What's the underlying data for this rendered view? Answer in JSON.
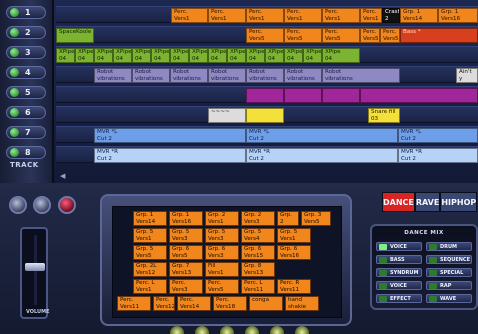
{
  "track_panel": {
    "tracks": [
      {
        "num": "1"
      },
      {
        "num": "2"
      },
      {
        "num": "3"
      },
      {
        "num": "4"
      },
      {
        "num": "5"
      },
      {
        "num": "6"
      },
      {
        "num": "7"
      },
      {
        "num": "8"
      }
    ],
    "label": "TRACK"
  },
  "lanes": [
    {
      "clips": [
        {
          "text": "Perc.\nVers1",
          "color": "orange"
        },
        {
          "text": "Perc.\nVers1",
          "color": "orange"
        },
        {
          "text": "Perc.\nVers1",
          "color": "orange"
        },
        {
          "text": "Perc.\nVers1",
          "color": "orange"
        },
        {
          "text": "Perc.\nVers1",
          "color": "orange"
        },
        {
          "text": "Perc.\nVers1",
          "color": "orange"
        },
        {
          "text": "Crash\n2",
          "color": "dark"
        },
        {
          "text": "Grp. 1\nVers14",
          "color": "orange"
        },
        {
          "text": "Grp. 1\nVers16",
          "color": "orange"
        }
      ]
    },
    {
      "clips": [
        {
          "text": "SpaceKoole",
          "color": "green"
        },
        {
          "text": "Perc.\nVers5",
          "color": "orange"
        },
        {
          "text": "Perc.\nVers5",
          "color": "orange"
        },
        {
          "text": "Perc.\nVers5",
          "color": "orange"
        },
        {
          "text": "Perc.\nVers5",
          "color": "orange"
        },
        {
          "text": "Perc.\nVers5",
          "color": "orange"
        },
        {
          "text": "Bass *",
          "color": "red"
        }
      ]
    },
    {
      "clips": [
        {
          "text": "XPipe\n04",
          "color": "green"
        },
        {
          "text": "XPipe\n04",
          "color": "green"
        },
        {
          "text": "XPipe\n04",
          "color": "green"
        },
        {
          "text": "XPipe\n04",
          "color": "green"
        },
        {
          "text": "XPipe\n04",
          "color": "green"
        },
        {
          "text": "XPipe\n04",
          "color": "green"
        },
        {
          "text": "XPipe\n04",
          "color": "green"
        },
        {
          "text": "XPipe\n04",
          "color": "green"
        },
        {
          "text": "XPipe\n04",
          "color": "green"
        },
        {
          "text": "XPipe\n04",
          "color": "green"
        },
        {
          "text": "XPipe\n04",
          "color": "green"
        },
        {
          "text": "XPipe\n04",
          "color": "green"
        },
        {
          "text": "XPipe\n04",
          "color": "green"
        },
        {
          "text": "XPipe\n04",
          "color": "green"
        },
        {
          "text": "XPipe\n04",
          "color": "green"
        }
      ]
    },
    {
      "clips": [
        {
          "text": "Robot\nvibrations",
          "color": "purple"
        },
        {
          "text": "Robot\nvibrations",
          "color": "purple"
        },
        {
          "text": "Robot\nvibrations",
          "color": "purple"
        },
        {
          "text": "Robot\nvibrations",
          "color": "purple"
        },
        {
          "text": "Robot\nvibrations",
          "color": "purple"
        },
        {
          "text": "Robot\nvibrations",
          "color": "purple"
        },
        {
          "text": "Robot\nvibrations",
          "color": "purple"
        },
        {
          "text": "Ain't y",
          "color": "white"
        }
      ]
    },
    {
      "clips": [
        {
          "text": "",
          "color": "magenta"
        },
        {
          "text": "",
          "color": "magenta"
        },
        {
          "text": "",
          "color": "magenta"
        },
        {
          "text": "",
          "color": "magenta"
        }
      ]
    },
    {
      "clips": [
        {
          "text": "~~~~",
          "color": "white"
        },
        {
          "text": "",
          "color": "yellow"
        },
        {
          "text": "Snare fill\n03",
          "color": "yellow"
        }
      ]
    },
    {
      "clips": [
        {
          "text": "MVR *L\nCut 2",
          "color": "blue"
        },
        {
          "text": "MVR *L\nCut 2",
          "color": "blue"
        },
        {
          "text": "MVR *L\nCut 2",
          "color": "blue"
        }
      ]
    },
    {
      "clips": [
        {
          "text": "MVR *R\nCut 2",
          "color": "lightblue"
        },
        {
          "text": "MVR *R\nCut 2",
          "color": "lightblue"
        },
        {
          "text": "MVR *R\nCut 2",
          "color": "lightblue"
        }
      ]
    }
  ],
  "volume": {
    "label": "VOLUME",
    "level": 0.55
  },
  "style_buttons": [
    {
      "label": "DANCE",
      "active": true
    },
    {
      "label": "RAVE",
      "active": false
    },
    {
      "label": "HIPHOP",
      "active": false
    }
  ],
  "mixer": {
    "title": "DANCE MIX",
    "channels": [
      {
        "label": "VOICE",
        "on": true
      },
      {
        "label": "DRUM",
        "on": false
      },
      {
        "label": "BASS",
        "on": false
      },
      {
        "label": "SEQUENCE",
        "on": false
      },
      {
        "label": "SYNDRUM",
        "on": false
      },
      {
        "label": "SPECIAL",
        "on": false
      },
      {
        "label": "VOICE",
        "on": false
      },
      {
        "label": "RAP",
        "on": false
      },
      {
        "label": "EFFECT",
        "on": false
      },
      {
        "label": "WAVE",
        "on": false
      }
    ]
  },
  "sample_grid": {
    "rows": [
      [
        "Grp. 1\nVers14",
        "Grp. 1\nVers16",
        "Grp. 2\nVers1",
        "Grp. 2\nVers3",
        "Grp. 2\nVers4",
        "Grp. 3\nVers5"
      ],
      [
        "Grp. 5\nVers1",
        "Grp. 5\nVers3",
        "Grp. 5\nVers3",
        "Grp. 5\nVers4",
        "Grp. 5\nVers1"
      ],
      [
        "Grp. 5\nVers5",
        "Grp. 6\nVers5",
        "Grp. 6\nVers3",
        "Grp. 6\nVers15",
        "Grp. 6\nVers16"
      ],
      [
        "Grp. 2L\nVers12",
        "Grp. 7\nVers13",
        "Fill\nVers1",
        "Grp. 8\nVers13"
      ],
      [
        "Perc. L\nVers1",
        "Perc.\nVers3",
        "Perc.\nVers5",
        "Perc. L\nVers11",
        "Perc. R\nVers11"
      ],
      [
        "Perc.\nVers11",
        "Perc.\nVers12",
        "Perc.\nVers14",
        "Perc.\nVers18",
        "conga",
        "hand\nshakie"
      ]
    ]
  }
}
